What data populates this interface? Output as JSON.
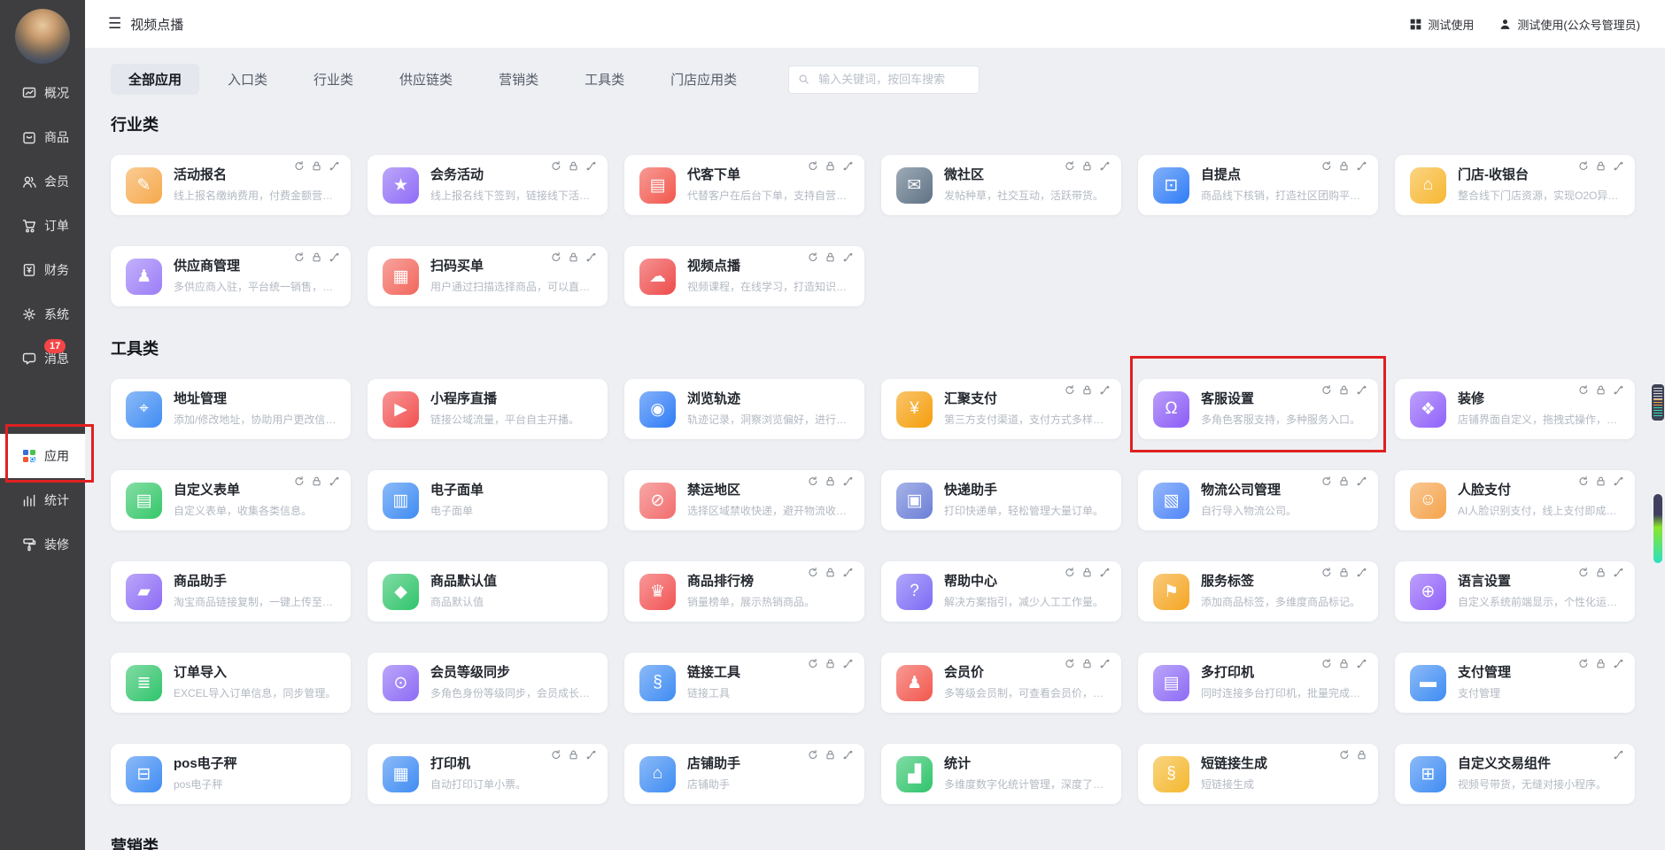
{
  "app": {
    "title": "视频点播"
  },
  "header": {
    "workspace_label": "测试使用",
    "account_label": "测试使用(公众号管理员)"
  },
  "sidebar": {
    "items": [
      {
        "key": "overview",
        "label": "概况",
        "icon": "dashboard-icon"
      },
      {
        "key": "goods",
        "label": "商品",
        "icon": "goods-icon"
      },
      {
        "key": "members",
        "label": "会员",
        "icon": "members-icon"
      },
      {
        "key": "orders",
        "label": "订单",
        "icon": "cart-icon"
      },
      {
        "key": "finance",
        "label": "财务",
        "icon": "finance-icon"
      },
      {
        "key": "system",
        "label": "系统",
        "icon": "gear-icon"
      },
      {
        "key": "messages",
        "label": "消息",
        "icon": "message-icon",
        "badge": "17"
      },
      {
        "key": "apps",
        "label": "应用",
        "icon": "apps-icon",
        "active": true,
        "gap_before": true,
        "annotated": true
      },
      {
        "key": "stats",
        "label": "统计",
        "icon": "chart-icon"
      },
      {
        "key": "decorate",
        "label": "装修",
        "icon": "paint-icon"
      }
    ]
  },
  "tabs": [
    {
      "key": "all",
      "label": "全部应用",
      "active": true
    },
    {
      "key": "entry",
      "label": "入口类"
    },
    {
      "key": "industry",
      "label": "行业类"
    },
    {
      "key": "supply",
      "label": "供应链类"
    },
    {
      "key": "marketing",
      "label": "营销类"
    },
    {
      "key": "tools",
      "label": "工具类"
    },
    {
      "key": "store",
      "label": "门店应用类"
    }
  ],
  "search": {
    "placeholder": "输入关键词，按回车搜索"
  },
  "sections": [
    {
      "heading": "行业类",
      "cards": [
        {
          "title": "活动报名",
          "desc": "线上报名缴纳费用，付费金额营…",
          "icon": "pencil-icon",
          "glyph": "✎",
          "color": "#f6a94c",
          "badges": [
            "sync",
            "lock",
            "link"
          ]
        },
        {
          "title": "会务活动",
          "desc": "线上报名线下签到，链接线下活…",
          "icon": "star-icon",
          "glyph": "★",
          "color": "#8f6bf6",
          "badges": [
            "sync",
            "lock",
            "link"
          ]
        },
        {
          "title": "代客下单",
          "desc": "代替客户在后台下单，支持自营…",
          "icon": "clipboard-icon",
          "glyph": "▤",
          "color": "#f2574d",
          "badges": [
            "sync",
            "lock",
            "link"
          ]
        },
        {
          "title": "微社区",
          "desc": "发帖种草，社交互动，活跃带货。",
          "icon": "chat-icon",
          "glyph": "✉",
          "color": "#5e7285",
          "badges": [
            "sync",
            "lock",
            "link"
          ]
        },
        {
          "title": "自提点",
          "desc": "商品线下核销，打造社区团购平…",
          "icon": "lock-icon",
          "glyph": "⊡",
          "color": "#2f7cf6",
          "badges": [
            "sync",
            "lock",
            "link"
          ]
        },
        {
          "title": "门店-收银台",
          "desc": "整合线下门店资源，实现O2O异…",
          "icon": "shop-icon",
          "glyph": "⌂",
          "color": "#f7b731",
          "badges": [
            "sync",
            "lock",
            "link"
          ]
        },
        {
          "title": "供应商管理",
          "desc": "多供应商入驻，平台统一销售，…",
          "icon": "person-icon",
          "glyph": "♟",
          "color": "#9b7df7",
          "badges": [
            "sync",
            "lock",
            "link"
          ]
        },
        {
          "title": "扫码买单",
          "desc": "用户通过扫描选择商品，可以直…",
          "icon": "scan-icon",
          "glyph": "▦",
          "color": "#f2665c",
          "badges": [
            "sync",
            "lock",
            "link"
          ]
        },
        {
          "title": "视频点播",
          "desc": "视频课程，在线学习，打造知识…",
          "icon": "cloud-play-icon",
          "glyph": "☁",
          "color": "#ee4b4b",
          "badges": [
            "sync",
            "lock",
            "link"
          ]
        }
      ]
    },
    {
      "heading": "工具类",
      "cards": [
        {
          "title": "地址管理",
          "desc": "添加/修改地址，协助用户更改信…",
          "icon": "location-icon",
          "glyph": "⌖",
          "color": "#3f8cf3",
          "badges": []
        },
        {
          "title": "小程序直播",
          "desc": "链接公域流量，平台自主开播。",
          "icon": "live-icon",
          "glyph": "▶",
          "color": "#f25050",
          "badges": []
        },
        {
          "title": "浏览轨迹",
          "desc": "轨迹记录，洞察浏览偏好，进行…",
          "icon": "track-icon",
          "glyph": "◉",
          "color": "#2f7cf6",
          "badges": []
        },
        {
          "title": "汇聚支付",
          "desc": "第三方支付渠道，支付方式多样…",
          "icon": "coin-icon",
          "glyph": "¥",
          "color": "#f59e0b",
          "badges": [
            "sync",
            "lock",
            "link"
          ]
        },
        {
          "title": "客服设置",
          "desc": "多角色客服支持，多种服务入口。",
          "icon": "headset-icon",
          "glyph": "Ω",
          "color": "#8b5cf6",
          "badges": [
            "sync",
            "lock",
            "link"
          ],
          "annotated": true
        },
        {
          "title": "装修",
          "desc": "店铺界面自定义，拖拽式操作，…",
          "icon": "paint-icon",
          "glyph": "❖",
          "color": "#9061f9",
          "badges": [
            "sync",
            "lock",
            "link"
          ]
        },
        {
          "title": "自定义表单",
          "desc": "自定义表单，收集各类信息。",
          "icon": "form-icon",
          "glyph": "▤",
          "color": "#34c769",
          "badges": [
            "sync",
            "lock",
            "link"
          ]
        },
        {
          "title": "电子面单",
          "desc": "电子面单",
          "icon": "sheet-icon",
          "glyph": "▥",
          "color": "#3f8cf3",
          "badges": []
        },
        {
          "title": "禁运地区",
          "desc": "选择区域禁收快递，避开物流收…",
          "icon": "ban-icon",
          "glyph": "⊘",
          "color": "#f26d6d",
          "badges": [
            "sync",
            "lock",
            "link"
          ]
        },
        {
          "title": "快递助手",
          "desc": "打印快递单，轻松管理大量订单。",
          "icon": "truck-icon",
          "glyph": "▣",
          "color": "#6b7fd7",
          "badges": []
        },
        {
          "title": "物流公司管理",
          "desc": "自行导入物流公司。",
          "icon": "box-icon",
          "glyph": "▧",
          "color": "#4f86f7",
          "badges": [
            "sync",
            "lock",
            "link"
          ]
        },
        {
          "title": "人脸支付",
          "desc": "AI人脸识别支付，线上支付即成…",
          "icon": "face-icon",
          "glyph": "☺",
          "color": "#f5a34b",
          "badges": [
            "sync",
            "lock",
            "link"
          ]
        },
        {
          "title": "商品助手",
          "desc": "淘宝商品链接复制，一键上传至…",
          "icon": "briefcase-icon",
          "glyph": "▰",
          "color": "#8d6bf5",
          "badges": []
        },
        {
          "title": "商品默认值",
          "desc": "商品默认值",
          "icon": "bag-icon",
          "glyph": "◆",
          "color": "#2fc46a",
          "badges": []
        },
        {
          "title": "商品排行榜",
          "desc": "销量榜单，展示热销商品。",
          "icon": "trophy-icon",
          "glyph": "♛",
          "color": "#f25454",
          "badges": [
            "sync",
            "lock",
            "link"
          ]
        },
        {
          "title": "帮助中心",
          "desc": "解决方案指引，减少人工工作量。",
          "icon": "question-icon",
          "glyph": "?",
          "color": "#7d6bf5",
          "badges": [
            "sync",
            "lock",
            "link"
          ]
        },
        {
          "title": "服务标签",
          "desc": "添加商品标签，多维度商品标记。",
          "icon": "tag-icon",
          "glyph": "⚑",
          "color": "#f5a623",
          "badges": [
            "sync",
            "lock",
            "link"
          ]
        },
        {
          "title": "语言设置",
          "desc": "自定义系统前端显示，个性化运…",
          "icon": "globe-icon",
          "glyph": "⊕",
          "color": "#9061f9",
          "badges": [
            "sync",
            "lock",
            "link"
          ]
        },
        {
          "title": "订单导入",
          "desc": "EXCEL导入订单信息，同步管理。",
          "icon": "excel-icon",
          "glyph": "≣",
          "color": "#2fc46a",
          "badges": []
        },
        {
          "title": "会员等级同步",
          "desc": "多角色身份等级同步，会员成长…",
          "icon": "sync-circle-icon",
          "glyph": "⊙",
          "color": "#8d6bf5",
          "badges": []
        },
        {
          "title": "链接工具",
          "desc": "链接工具",
          "icon": "link-icon",
          "glyph": "§",
          "color": "#3f8cf3",
          "badges": [
            "sync",
            "lock",
            "link"
          ]
        },
        {
          "title": "会员价",
          "desc": "多等级会员制，可查看会员价，…",
          "icon": "member-icon",
          "glyph": "♟",
          "color": "#f2574d",
          "badges": [
            "sync",
            "lock",
            "link"
          ]
        },
        {
          "title": "多打印机",
          "desc": "同时连接多台打印机，批量完成…",
          "icon": "printer-icon",
          "glyph": "▤",
          "color": "#8d6bf5",
          "badges": [
            "sync",
            "lock",
            "link"
          ]
        },
        {
          "title": "支付管理",
          "desc": "支付管理",
          "icon": "card-icon",
          "glyph": "▬",
          "color": "#3f8cf3",
          "badges": [
            "sync",
            "lock",
            "link"
          ]
        },
        {
          "title": "pos电子秤",
          "desc": "pos电子秤",
          "icon": "scale-icon",
          "glyph": "⊟",
          "color": "#3f8cf3",
          "badges": []
        },
        {
          "title": "打印机",
          "desc": "自动打印订单小票。",
          "icon": "printer-icon",
          "glyph": "▦",
          "color": "#3f8cf3",
          "badges": [
            "sync",
            "lock",
            "link"
          ]
        },
        {
          "title": "店铺助手",
          "desc": "店铺助手",
          "icon": "store-icon",
          "glyph": "⌂",
          "color": "#3f8cf3",
          "badges": [
            "sync",
            "lock",
            "link"
          ]
        },
        {
          "title": "统计",
          "desc": "多维度数字化统计管理，深度了…",
          "icon": "chart-icon",
          "glyph": "▟",
          "color": "#2fc46a",
          "badges": []
        },
        {
          "title": "短链接生成",
          "desc": "短链接生成",
          "icon": "shortlink-icon",
          "glyph": "§",
          "color": "#f5b82e",
          "badges": [
            "sync",
            "lock"
          ]
        },
        {
          "title": "自定义交易组件",
          "desc": "视频号带货，无缝对接小程序。",
          "icon": "component-icon",
          "glyph": "⊞",
          "color": "#3f8cf3",
          "badges": [
            "link"
          ]
        }
      ]
    },
    {
      "heading": "营销类",
      "cards": []
    }
  ],
  "colors": {
    "annotation_red": "#e02020",
    "sidebar_bg": "#3e3e41",
    "page_bg": "#edeff3",
    "badge_red": "#f54545",
    "tab_active_bg": "#e4e7ed"
  }
}
